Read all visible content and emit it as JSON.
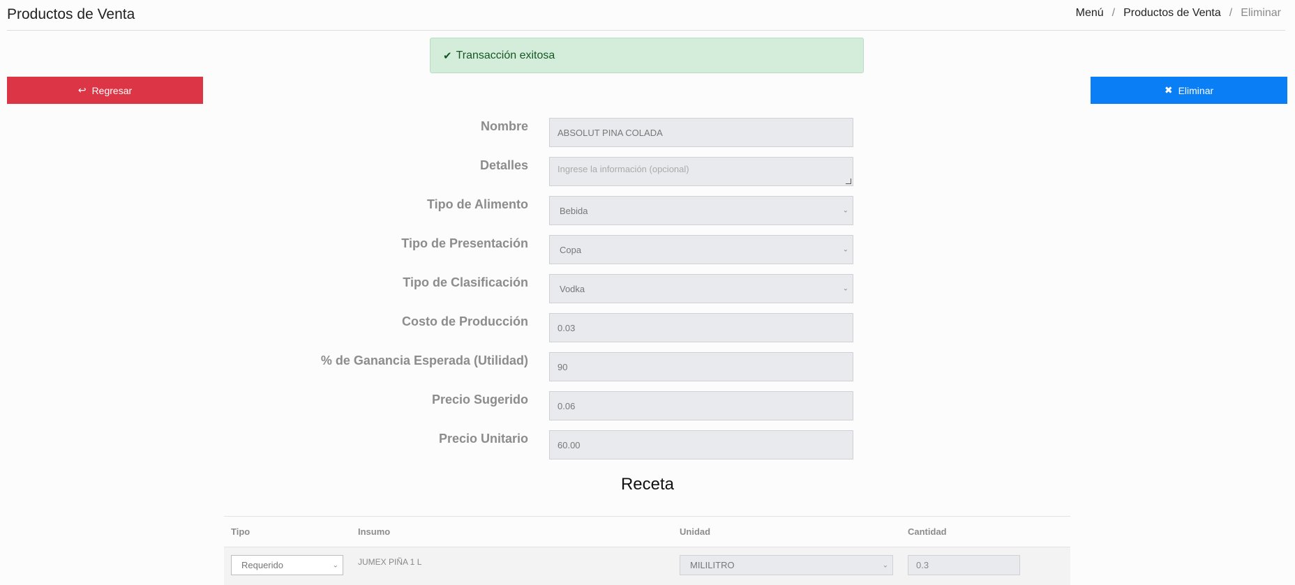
{
  "header": {
    "title": "Productos de Venta",
    "breadcrumb": [
      "Menú",
      "Productos de Venta",
      "Eliminar"
    ]
  },
  "alert": {
    "message": "Transacción exitosa",
    "icon": "check-icon"
  },
  "buttons": {
    "back": "Regresar",
    "delete": "Eliminar"
  },
  "form": {
    "nombre": {
      "label": "Nombre",
      "value": "ABSOLUT  PINA COLADA"
    },
    "detalles": {
      "label": "Detalles",
      "placeholder": "Ingrese la información (opcional)"
    },
    "tipo_alimento": {
      "label": "Tipo de Alimento",
      "value": "Bebida"
    },
    "tipo_presentacion": {
      "label": "Tipo de Presentación",
      "value": "Copa"
    },
    "tipo_clasificacion": {
      "label": "Tipo de Clasificación",
      "value": "Vodka"
    },
    "costo_produccion": {
      "label": "Costo de Producción",
      "value": "0.03"
    },
    "ganancia": {
      "label": "% de Ganancia Esperada (Utilidad)",
      "value": "90"
    },
    "precio_sugerido": {
      "label": "Precio Sugerido",
      "value": "0.06"
    },
    "precio_unitario": {
      "label": "Precio Unitario",
      "value": "60.00"
    }
  },
  "recipe": {
    "title": "Receta",
    "columns": [
      "Tipo",
      "Insumo",
      "Unidad",
      "Cantidad"
    ],
    "rows": [
      {
        "tipo": "Requerido",
        "insumo": "JUMEX PIÑA 1 L",
        "unidad": "MILILITRO",
        "cantidad": "0.3"
      }
    ]
  },
  "colors": {
    "danger": "#dc3545",
    "primary": "#0a7ef5",
    "success_bg": "#d4edda",
    "success_text": "#155724"
  }
}
